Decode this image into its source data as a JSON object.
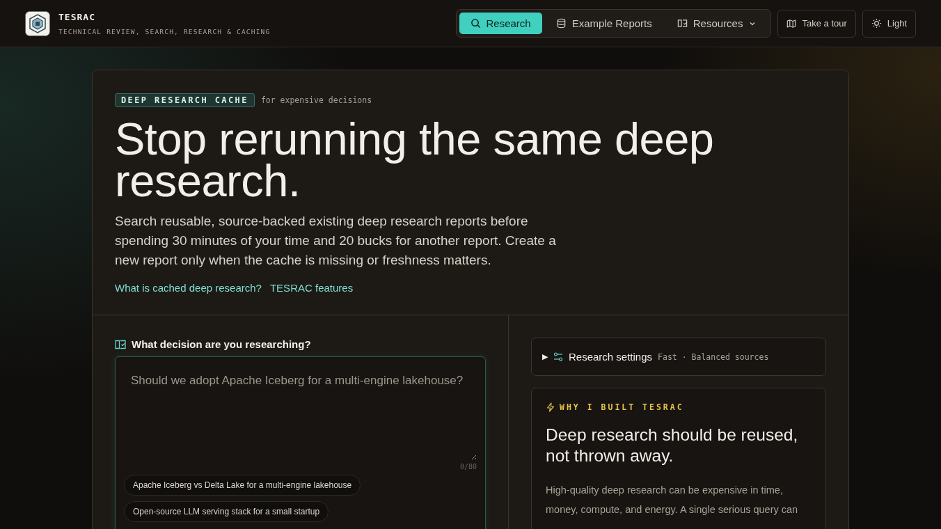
{
  "brand": {
    "name": "TESRAC",
    "tagline": "TECHNICAL REVIEW, SEARCH, RESEARCH & CACHING"
  },
  "nav": {
    "tabs": [
      {
        "label": "Research",
        "selected": true
      },
      {
        "label": "Example Reports",
        "selected": false
      },
      {
        "label": "Resources",
        "selected": false,
        "dropdown": true
      }
    ],
    "buttons": [
      {
        "label": "Take a tour"
      },
      {
        "label": "Light"
      }
    ]
  },
  "hero": {
    "badge": "DEEP RESEARCH CACHE",
    "badge_note": "for expensive decisions",
    "title": "Stop rerunning the same deep research.",
    "description": "Search reusable, source-backed existing deep research reports before spending 30 minutes of your time and 20 bucks for another report. Create a new report only when the cache is missing or freshness matters.",
    "links": [
      "What is cached deep research?",
      "TESRAC features"
    ]
  },
  "question": {
    "label": "What decision are you researching?",
    "placeholder": "Should we adopt Apache Iceberg for a multi-engine lakehouse?",
    "counter": "0/80",
    "suggestions": [
      "Apache Iceberg vs Delta Lake for a multi-engine lakehouse",
      "Open-source LLM serving stack for a small startup"
    ]
  },
  "settings": {
    "label": "Research settings",
    "summary": "Fast · Balanced sources",
    "expanded": false,
    "toggle": "▶"
  },
  "why": {
    "eyebrow": "WHY I BUILT TESRAC",
    "title": "Deep research should be reused, not thrown away.",
    "body": "High-quality deep research can be expensive in time, money, compute, and energy. A single serious query can"
  }
}
